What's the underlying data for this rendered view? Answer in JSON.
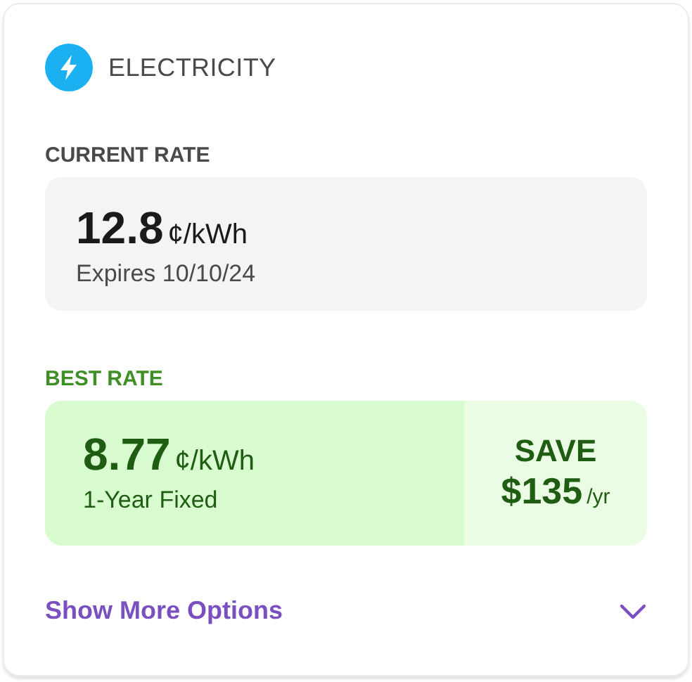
{
  "header": {
    "title": "ELECTRICITY"
  },
  "current_rate": {
    "label": "CURRENT RATE",
    "value": "12.8",
    "unit": "¢/kWh",
    "note": "Expires 10/10/24"
  },
  "best_rate": {
    "label": "BEST RATE",
    "value": "8.77",
    "unit": "¢/kWh",
    "plan": "1-Year Fixed",
    "save_label": "SAVE",
    "save_amount": "$135",
    "save_period": "/yr"
  },
  "more_options": {
    "label": "Show More Options",
    "expanded": false
  }
}
